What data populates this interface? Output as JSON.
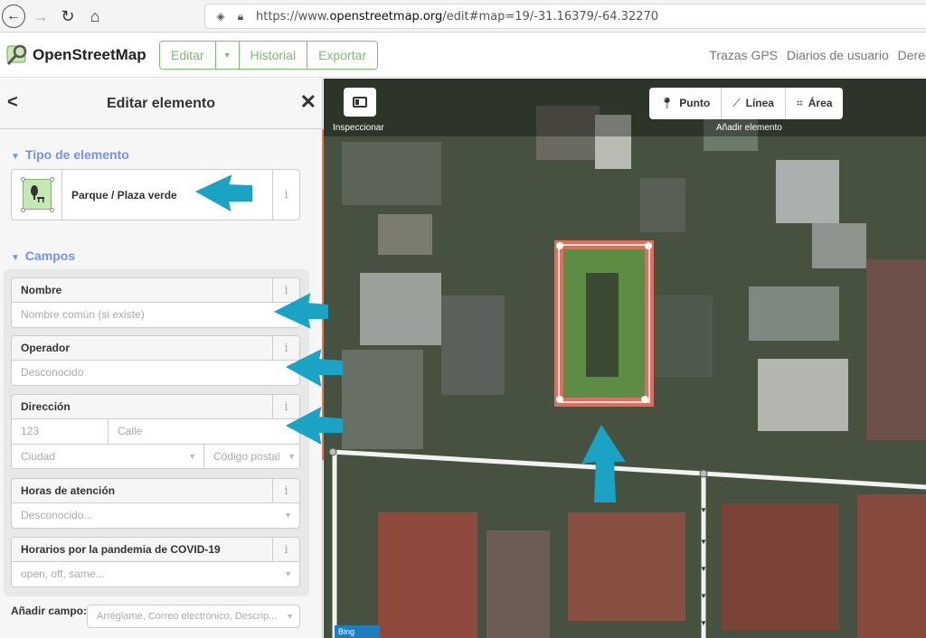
{
  "browser": {
    "url_prefix": "https://www.",
    "url_domain": "openstreetmap.org",
    "url_path": "/edit#map=19/-31.16379/-64.32270"
  },
  "osm": {
    "brand": "OpenStreetMap",
    "nav": {
      "edit": "Editar",
      "history": "Historial",
      "export": "Exportar"
    },
    "links": [
      "Trazas GPS",
      "Diarios de usuario",
      "Derec"
    ]
  },
  "sidebar": {
    "title": "Editar elemento",
    "type_section": "Tipo de elemento",
    "preset_name": "Parque / Plaza verde",
    "fields_section": "Campos",
    "fields": {
      "name": {
        "label": "Nombre",
        "placeholder": "Nombre común (si existe)"
      },
      "operator": {
        "label": "Operador",
        "placeholder": "Desconocido"
      },
      "address": {
        "label": "Dirección",
        "number": "123",
        "street": "Calle",
        "city": "Ciudad",
        "postcode": "Código postal"
      },
      "hours": {
        "label": "Horas de atención",
        "placeholder": "Desconocido..."
      },
      "covid": {
        "label": "Horarios por la pandemia de COVID-19",
        "placeholder": "open, off, same..."
      }
    },
    "add_field_label": "Añadir campo:",
    "add_field_placeholder": "Arréglame, Correo electrónico, Descrip..."
  },
  "map": {
    "inspect_label": "Inspeccionar",
    "modes": {
      "point": "Punto",
      "line": "Línea",
      "area": "Área"
    },
    "add_label": "Añadir elemento",
    "attribution": "Bing"
  },
  "colors": {
    "osm_green": "#7ebc6f",
    "accent_blue": "#7092ff",
    "selection_red": "#e06e5f",
    "annotation_arrow": "#1ba3c6"
  }
}
